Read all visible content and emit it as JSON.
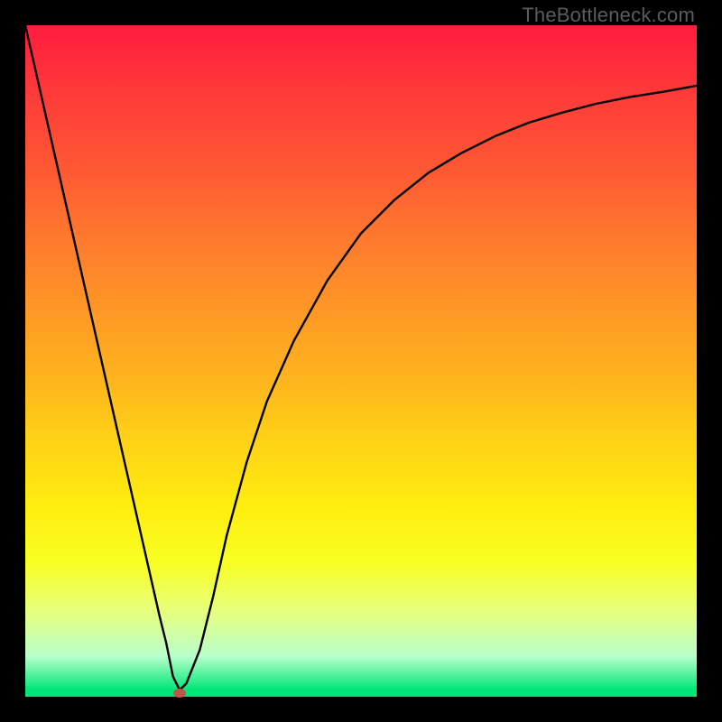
{
  "watermark": "TheBottleneck.com",
  "chart_data": {
    "type": "line",
    "title": "",
    "xlabel": "",
    "ylabel": "",
    "xlim": [
      0,
      100
    ],
    "ylim": [
      0,
      100
    ],
    "grid": false,
    "legend": false,
    "series": [
      {
        "name": "bottleneck-curve",
        "x": [
          0,
          5,
          10,
          15,
          20,
          21,
          22,
          23,
          24,
          26,
          28,
          30,
          33,
          36,
          40,
          45,
          50,
          55,
          60,
          65,
          70,
          75,
          80,
          85,
          90,
          95,
          100
        ],
        "values": [
          100,
          78,
          56,
          34,
          12,
          8,
          3,
          1,
          2,
          7,
          15,
          24,
          35,
          44,
          53,
          62,
          69,
          74,
          78,
          81,
          83.5,
          85.5,
          87,
          88.3,
          89.3,
          90.1,
          91
        ]
      }
    ],
    "marker": {
      "x": 23,
      "y": 0.5,
      "color": "#b85a4a"
    },
    "background_gradient": {
      "top": "#ff1c3e",
      "bottom": "#00e676",
      "stops": [
        "red",
        "orange",
        "yellow",
        "green"
      ]
    }
  }
}
